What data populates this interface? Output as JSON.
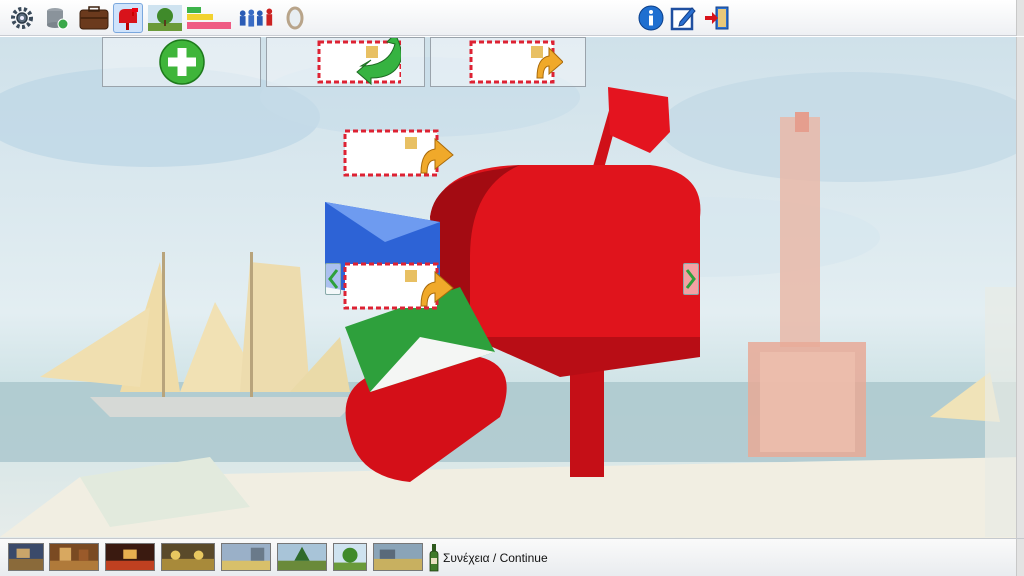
{
  "toolbar": {
    "left_icons": [
      "settings-icon",
      "database-icon",
      "suitcase-icon",
      "mailbox-icon",
      "tree-icon",
      "bar-chart-icon",
      "people-icon",
      "mirror-icon"
    ],
    "right_icons": [
      "info-icon",
      "edit-icon",
      "exit-icon"
    ]
  },
  "actions": [
    "new-message-icon",
    "reply-icon",
    "forward-icon"
  ],
  "scene": {
    "mailbox_color": "#d8131b",
    "flag_color": "#e0121f"
  },
  "bottombar": {
    "thumbnails": [
      "room-scene-1",
      "room-scene-2",
      "room-scene-3",
      "room-scene-4",
      "street-scene",
      "park-scene",
      "tree-scene",
      "yard-scene"
    ],
    "continue_label": "Συνέχεια / Continue"
  }
}
